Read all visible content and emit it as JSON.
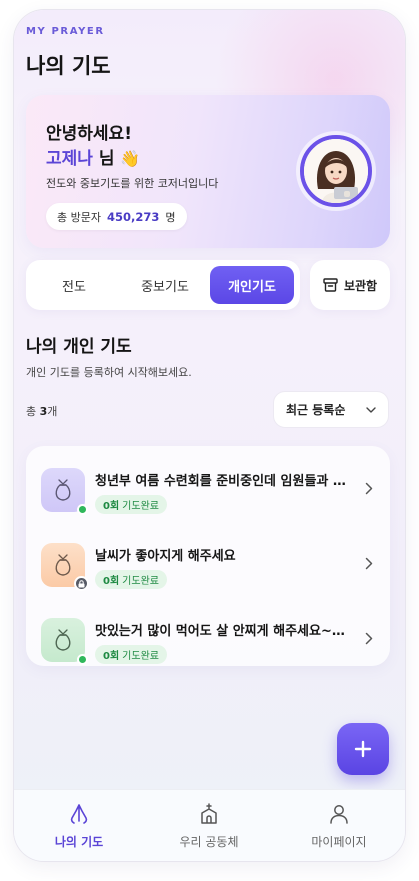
{
  "header": {
    "eyebrow": "MY PRAYER",
    "title": "나의 기도"
  },
  "hero": {
    "greeting": "안녕하세요!",
    "user_name": "고제나",
    "honorific": "님",
    "wave_emoji": "👋",
    "description": "전도와 중보기도를 위한 코저너입니다",
    "visitor_label": "총 방문자",
    "visitor_count": "450,273",
    "visitor_unit": "명"
  },
  "tabs": [
    {
      "label": "전도",
      "active": false
    },
    {
      "label": "중보기도",
      "active": false
    },
    {
      "label": "개인기도",
      "active": true
    }
  ],
  "archive": {
    "label": "보관함",
    "icon": "archive-box-icon"
  },
  "section": {
    "title": "나의 개인 기도",
    "description": "개인 기도를 등록하여 시작해보세요.",
    "total_prefix": "총",
    "total_count": "3",
    "total_suffix": "개",
    "sort_selected": "최근 등록순"
  },
  "prayers": [
    {
      "title": "청년부 여름 수련회를 준비중인데 임원들과 싸...",
      "count": "0회",
      "status": "기도완료",
      "icon_color": "#d9d3fa",
      "indicator": "online-dot"
    },
    {
      "title": "날씨가 좋아지게 해주세요",
      "count": "0회",
      "status": "기도완료",
      "icon_color": "#fcd7b9",
      "indicator": "lock"
    },
    {
      "title": "맛있는거 많이 먹어도 살 안찌게 해주세요~!! 아...",
      "count": "0회",
      "status": "기도완료",
      "icon_color": "#d1eed7",
      "indicator": "online-dot"
    }
  ],
  "colors": {
    "accent": "#5b47e6",
    "success": "#1f8a43",
    "success_bg": "#e4f5e8"
  },
  "bottom_nav": [
    {
      "label": "나의 기도",
      "icon": "praying-hands-icon",
      "active": true
    },
    {
      "label": "우리 공동체",
      "icon": "church-icon",
      "active": false
    },
    {
      "label": "마이페이지",
      "icon": "person-icon",
      "active": false
    }
  ]
}
